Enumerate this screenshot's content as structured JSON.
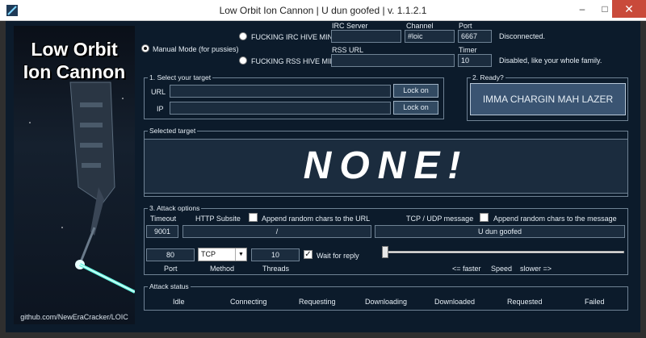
{
  "window": {
    "title": "Low Orbit Ion Cannon | U dun goofed | v. 1.1.2.1",
    "minimize_label": "–",
    "maximize_label": "□",
    "close_label": "✕"
  },
  "logo": {
    "line1": "Low Orbit",
    "line2": "Ion Cannon",
    "footer": "github.com/NewEraCracker/LOIC"
  },
  "mode": {
    "manual_label": "Manual Mode (for pussies)",
    "irc_label": "FUCKING IRC HIVE MIND",
    "rss_label": "FUCKING RSS HIVE MIND",
    "selected": "manual"
  },
  "irc": {
    "server_label": "IRC Server",
    "server_value": "",
    "channel_label": "Channel",
    "channel_value": "#loic",
    "port_label": "Port",
    "port_value": "6667",
    "status": "Disconnected."
  },
  "rss": {
    "url_label": "RSS URL",
    "url_value": "",
    "timer_label": "Timer",
    "timer_value": "10",
    "status": "Disabled, like your whole family."
  },
  "target": {
    "section_title": "1. Select your target",
    "url_label": "URL",
    "url_value": "",
    "ip_label": "IP",
    "ip_value": "",
    "lock_label": "Lock on"
  },
  "ready": {
    "section_title": "2. Ready?",
    "fire_label": "IMMA CHARGIN MAH LAZER"
  },
  "selected_target": {
    "section_title": "Selected target",
    "value": "NONE!"
  },
  "attack_options": {
    "section_title": "3. Attack options",
    "timeout_label": "Timeout",
    "timeout_value": "9001",
    "subsite_label": "HTTP Subsite",
    "subsite_value": "/",
    "append_url_label": "Append random chars to the URL",
    "append_url_checked": false,
    "message_label": "TCP / UDP message",
    "message_value": "U dun goofed",
    "append_msg_label": "Append random chars to the message",
    "append_msg_checked": false,
    "port_value": "80",
    "port_label": "Port",
    "method_value": "TCP",
    "method_label": "Method",
    "threads_value": "10",
    "threads_label": "Threads",
    "wait_label": "Wait for reply",
    "wait_checked": true,
    "speed_faster": "<= faster",
    "speed_label": "Speed",
    "speed_slower": "slower =>",
    "speed_level": 0
  },
  "attack_status": {
    "section_title": "Attack status",
    "columns": [
      "Idle",
      "Connecting",
      "Requesting",
      "Downloading",
      "Downloaded",
      "Requested",
      "Failed"
    ]
  }
}
